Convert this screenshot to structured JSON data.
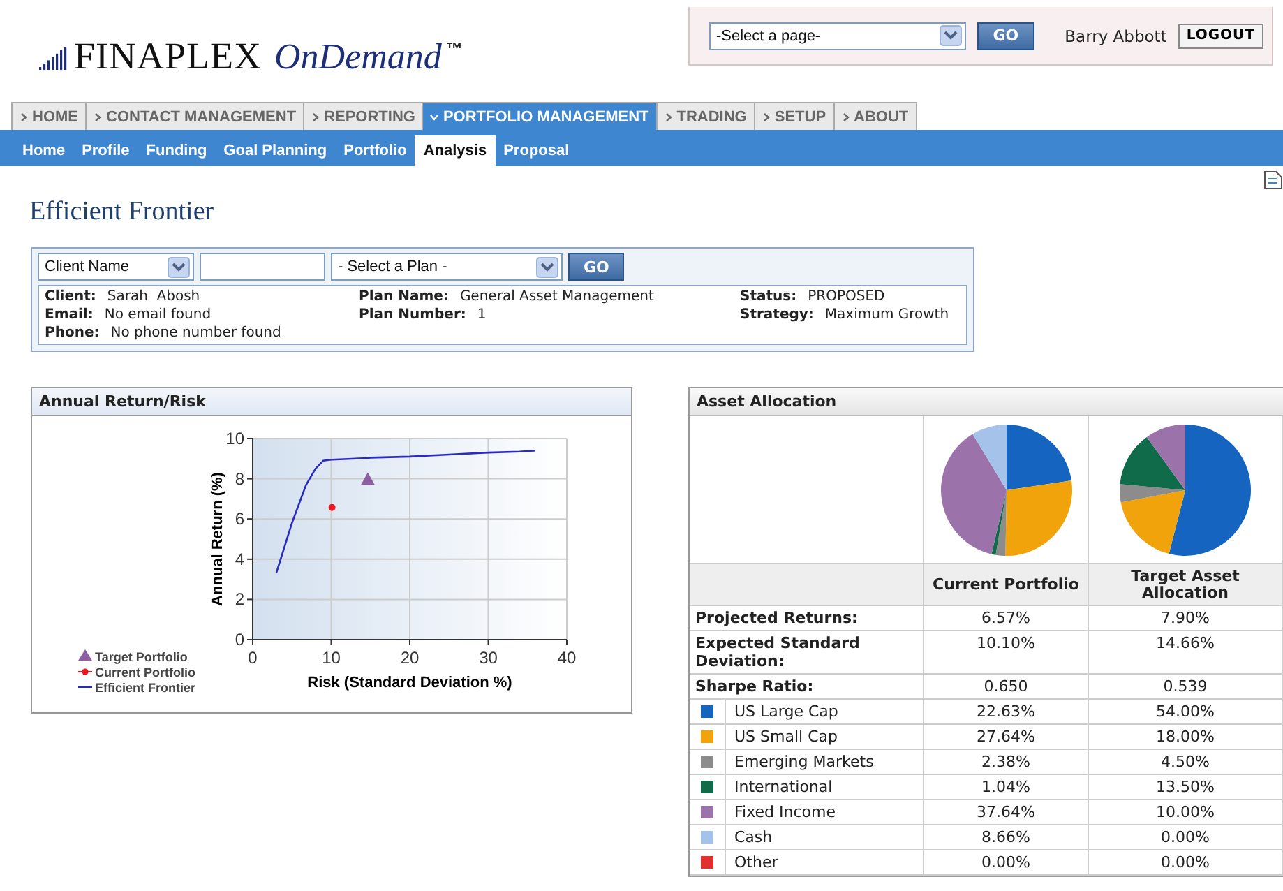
{
  "logo": {
    "brand": "FINAPLEX",
    "product": "OnDemand",
    "mark": "™"
  },
  "account": {
    "page_select": "-Select a page-",
    "go": "GO",
    "user": "Barry Abbott",
    "logout": "LOGOUT"
  },
  "main_tabs": [
    {
      "label": "HOME",
      "selected": false
    },
    {
      "label": "CONTACT MANAGEMENT",
      "selected": false
    },
    {
      "label": "REPORTING",
      "selected": false
    },
    {
      "label": "PORTFOLIO MANAGEMENT",
      "selected": true
    },
    {
      "label": "TRADING",
      "selected": false
    },
    {
      "label": "SETUP",
      "selected": false
    },
    {
      "label": "ABOUT",
      "selected": false
    }
  ],
  "sub_tabs": [
    {
      "label": "Home",
      "selected": false
    },
    {
      "label": "Profile",
      "selected": false
    },
    {
      "label": "Funding",
      "selected": false
    },
    {
      "label": "Goal Planning",
      "selected": false
    },
    {
      "label": "Portfolio",
      "selected": false
    },
    {
      "label": "Analysis",
      "selected": true
    },
    {
      "label": "Proposal",
      "selected": false
    }
  ],
  "page_title": "Efficient Frontier",
  "search": {
    "field_select": "Client Name",
    "plan_select": "- Select a Plan -",
    "go": "GO"
  },
  "client_info": [
    [
      {
        "label": "Client:",
        "value": "Sarah  Abosh"
      },
      {
        "label": "Email:",
        "value": "No email found"
      },
      {
        "label": "Phone:",
        "value": "No phone number found"
      }
    ],
    [
      {
        "label": "Plan Name:",
        "value": "General Asset Management"
      },
      {
        "label": "Plan Number:",
        "value": "1"
      }
    ],
    [
      {
        "label": "Status:",
        "value": "PROPOSED"
      },
      {
        "label": "Strategy:",
        "value": "Maximum Growth"
      }
    ]
  ],
  "risk_panel": {
    "title": "Annual Return/Risk",
    "chart_data": {
      "type": "line",
      "xlabel": "Risk (Standard Deviation %)",
      "ylabel": "Annual Return (%)",
      "xlim": [
        0,
        40
      ],
      "ylim": [
        0,
        10
      ],
      "xticks": [
        0,
        10,
        20,
        30,
        40
      ],
      "yticks": [
        0,
        2,
        4,
        6,
        8,
        10
      ],
      "grid": true,
      "legend": "bottom-left",
      "x": [
        3,
        5,
        6.8,
        8,
        9,
        10,
        10.1,
        14.66,
        15,
        20,
        25,
        30,
        34,
        36
      ],
      "series": [
        {
          "name": "Target Portfolio",
          "color": "#8e5ea2",
          "marker": "triangle",
          "values": [
            null,
            null,
            null,
            null,
            null,
            null,
            null,
            7.9,
            null,
            null,
            null,
            null,
            null,
            null
          ]
        },
        {
          "name": "Current Portfolio",
          "color": "#e8191f",
          "marker": "circle",
          "values": [
            null,
            null,
            null,
            null,
            null,
            null,
            6.57,
            null,
            null,
            null,
            null,
            null,
            null,
            null
          ]
        },
        {
          "name": "Efficient Frontier",
          "color": "#2a2ac0",
          "values": [
            3.3,
            5.8,
            7.7,
            8.5,
            8.9,
            8.95,
            8.95,
            9.03,
            9.05,
            9.1,
            9.2,
            9.3,
            9.35,
            9.4
          ]
        }
      ]
    }
  },
  "allocation": {
    "title": "Asset Allocation",
    "columns": [
      "Current Portfolio",
      "Target Asset Allocation"
    ],
    "metrics": [
      {
        "label": "Projected Returns:",
        "values": [
          "6.57%",
          "7.90%"
        ]
      },
      {
        "label": "Expected Standard Deviation:",
        "values": [
          "10.10%",
          "14.66%"
        ]
      },
      {
        "label": "Sharpe Ratio:",
        "values": [
          "0.650",
          "0.539"
        ]
      }
    ],
    "assets": [
      {
        "name": "US Large Cap",
        "color": "#1565c0",
        "values": [
          "22.63%",
          "54.00%"
        ]
      },
      {
        "name": "US Small Cap",
        "color": "#f0a30a",
        "values": [
          "27.64%",
          "18.00%"
        ]
      },
      {
        "name": "Emerging Markets",
        "color": "#8c8c8c",
        "values": [
          "2.38%",
          "4.50%"
        ]
      },
      {
        "name": "International",
        "color": "#0f6b4a",
        "values": [
          "1.04%",
          "13.50%"
        ]
      },
      {
        "name": "Fixed Income",
        "color": "#9b72aa",
        "values": [
          "37.64%",
          "10.00%"
        ]
      },
      {
        "name": "Cash",
        "color": "#a4c2ea",
        "values": [
          "8.66%",
          "0.00%"
        ]
      },
      {
        "name": "Other",
        "color": "#e03030",
        "values": [
          "0.00%",
          "0.00%"
        ]
      }
    ]
  }
}
